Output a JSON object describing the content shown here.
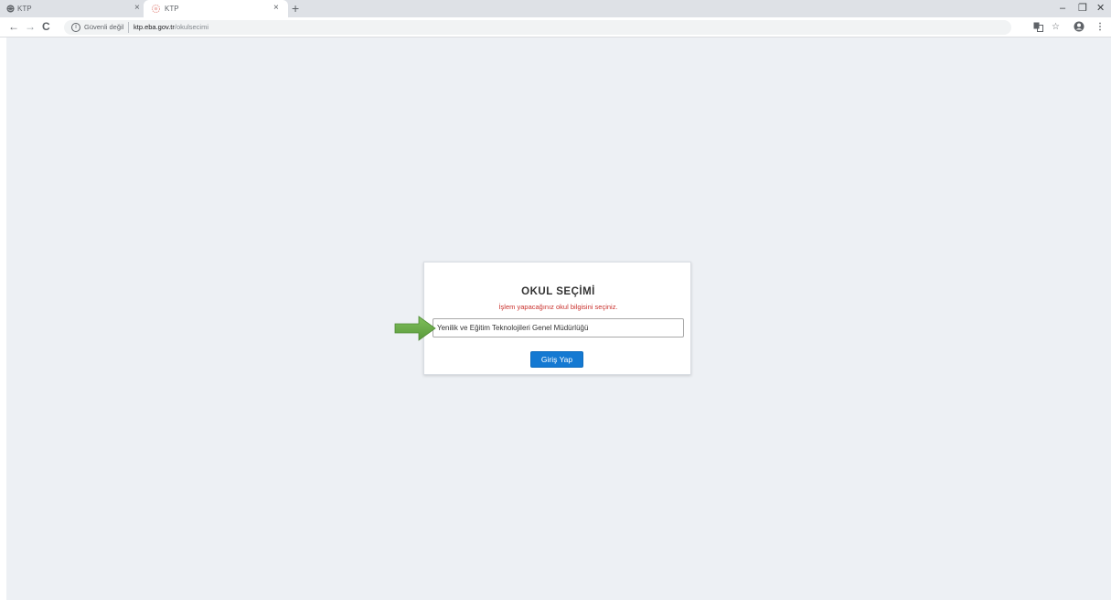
{
  "browser": {
    "tabs": [
      {
        "title": "KTP",
        "close": "×"
      },
      {
        "title": "KTP",
        "close": "×"
      }
    ],
    "new_tab": "+",
    "window_controls": {
      "minimize": "–",
      "restore": "❐",
      "close": "✕"
    },
    "nav": {
      "back": "←",
      "forward": "→",
      "reload": "C"
    },
    "address_bar": {
      "security_text": "Güvenli değil",
      "url_host": "ktp.eba.gov.tr",
      "url_path": "/okulsecimi"
    },
    "toolbar_icons": [
      "translate-icon",
      "bookmark-star-icon",
      "account-icon",
      "menu-icon"
    ]
  },
  "page": {
    "title": "OKUL SEÇİMİ",
    "subtitle": "İşlem yapacağınız okul bilgisini seçiniz.",
    "school_select": {
      "selected": "Yenilik ve Eğitim Teknolojileri Genel Müdürlüğü"
    },
    "login_button": "Giriş Yap"
  },
  "colors": {
    "page_background": "#edf0f4",
    "subtitle": "#c9302c",
    "button": "#1479d2",
    "arrow": "#6aa84f"
  }
}
